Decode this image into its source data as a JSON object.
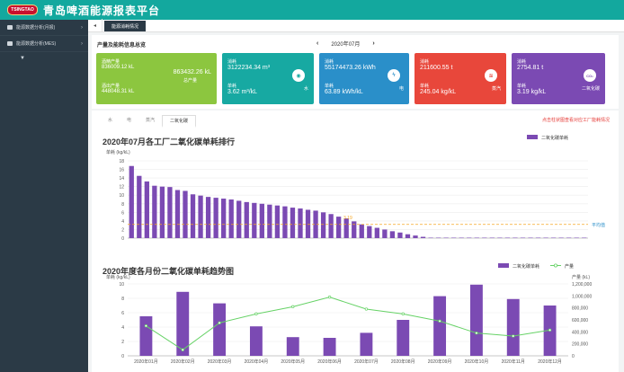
{
  "header": {
    "logo_text": "TSINGTAO",
    "title": "青岛啤酒能源报表平台"
  },
  "sidebar": {
    "items": [
      {
        "label": "能源数据分析(月报)"
      },
      {
        "label": "能源数据分析(MES)"
      }
    ]
  },
  "tabs": {
    "active_label": "能源消耗情况"
  },
  "overview": {
    "title": "产量及能耗信息总览",
    "month": "2020年07月",
    "cards": [
      {
        "l1": "酒精产量",
        "v1": "836009.12 kL",
        "l3": "酒出产量",
        "v3": "448048.31 kL",
        "big": "863432.26 kL",
        "sub": "总产量"
      },
      {
        "l1": "消耗",
        "v1": "3122234.34 m³",
        "l3": "单耗",
        "v3": "3.62 m³/kL",
        "name": "水",
        "icon": "drop-icon"
      },
      {
        "l1": "消耗",
        "v1": "55174473.26 kWh",
        "l3": "单耗",
        "v3": "63.89 kWh/kL",
        "name": "电",
        "icon": "bolt-icon"
      },
      {
        "l1": "消耗",
        "v1": "211600.55 t",
        "l3": "单耗",
        "v3": "245.04 kg/kL",
        "name": "蒸汽",
        "icon": "steam-icon"
      },
      {
        "l1": "消耗",
        "v1": "2754.81 t",
        "l3": "单耗",
        "v3": "3.19 kg/kL",
        "name": "二氧化碳",
        "icon": "co2-icon"
      }
    ],
    "colors": {
      "yield": "#8cc63f",
      "water": "#17a9a2",
      "power": "#2a8fc9",
      "steam": "#e8473b",
      "co2": "#7b4ab3"
    }
  },
  "subtabs": [
    "水",
    "电",
    "蒸汽",
    "二氧化碳"
  ],
  "warning": "点击柱状图查看对应工厂能耗情况",
  "chart_data": [
    {
      "type": "bar",
      "title": "2020年07月各工厂二氧化碳单耗排行",
      "ylabel": "单耗 (kg/kL)",
      "legend": [
        "二氧化碳单耗"
      ],
      "ylim": [
        0,
        18
      ],
      "yticks": [
        0,
        2,
        4,
        6,
        8,
        10,
        12,
        14,
        16,
        18
      ],
      "values": [
        16.8,
        14.5,
        13.2,
        12.2,
        12.0,
        11.9,
        11.2,
        11.0,
        10.2,
        9.9,
        9.6,
        9.4,
        9.2,
        9.0,
        8.7,
        8.4,
        8.2,
        8.0,
        7.8,
        7.6,
        7.4,
        7.1,
        6.9,
        6.6,
        6.4,
        6.0,
        5.6,
        5.0,
        4.6,
        3.9,
        3.2,
        2.8,
        2.4,
        2.0,
        1.6,
        1.3,
        0.9,
        0.6,
        0.3,
        0.1,
        0.1,
        0.1,
        0.1,
        0.1,
        0.1,
        0.1,
        0.1,
        0.1,
        0.1,
        0.1,
        0.1,
        0.1,
        0.1,
        0.1,
        0.1,
        0.1,
        0.1,
        0.1,
        0.1,
        0.1
      ],
      "avg_value": 3.19,
      "avg_label": "平均值",
      "color": "#7b4ab3"
    },
    {
      "type": "bar",
      "title": "2020年度各月份二氧化碳单耗趋势图",
      "ylabel": "单耗 (kg/kL)",
      "y2label": "产量 (kL)",
      "legend": [
        "二氧化碳单耗",
        "产量"
      ],
      "categories": [
        "2020年01月",
        "2020年02月",
        "2020年03月",
        "2020年04月",
        "2020年05月",
        "2020年06月",
        "2020年07月",
        "2020年08月",
        "2020年09月",
        "2020年10月",
        "2020年11月",
        "2020年12月"
      ],
      "values": [
        5.5,
        8.9,
        7.3,
        4.1,
        2.6,
        2.5,
        3.2,
        5.0,
        8.3,
        9.9,
        7.9,
        7.0
      ],
      "series2_values": [
        500000,
        100000,
        550000,
        700000,
        820000,
        980000,
        780000,
        700000,
        580000,
        380000,
        330000,
        430000
      ],
      "ylim": [
        0,
        10
      ],
      "yticks": [
        0,
        2,
        4,
        6,
        8,
        10
      ],
      "y2lim": [
        0,
        1200000
      ],
      "y2ticks": [
        "0",
        "200,000",
        "400,000",
        "600,000",
        "800,000",
        "1,000,000",
        "1,200,000"
      ],
      "color": "#7b4ab3",
      "line_color": "#66d266"
    }
  ]
}
